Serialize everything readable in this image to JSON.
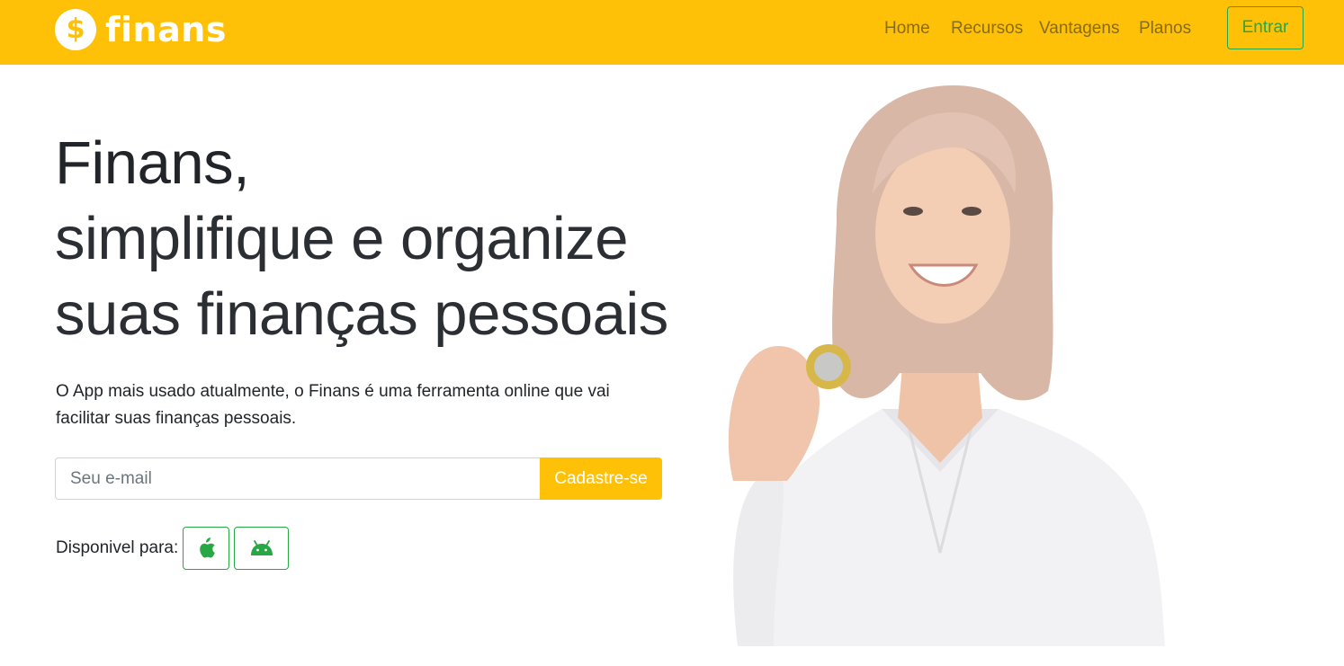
{
  "navbar": {
    "brand_icon_symbol": "$",
    "brand_name": "finans",
    "links": {
      "home": "Home",
      "recursos": "Recursos",
      "vantagens": "Vantagens",
      "planos": "Planos"
    },
    "login_label": "Entrar"
  },
  "hero": {
    "title_line1": "Finans,",
    "title_line2": "simplifique e organize",
    "title_line3": "suas finanças pessoais",
    "lead": "O App mais usado atualmente, o Finans é uma ferramenta online que vai facilitar suas finanças pessoais.",
    "email_placeholder": "Seu e-mail",
    "email_value": "",
    "signup_label": "Cadastre-se",
    "available_label": "Disponivel para:",
    "stores": [
      "apple-icon",
      "android-icon"
    ]
  },
  "colors": {
    "brand_yellow": "#ffc107",
    "success_green": "#28a745",
    "text_dark": "#212529",
    "nav_link": "rgba(33,37,41,0.55)"
  }
}
